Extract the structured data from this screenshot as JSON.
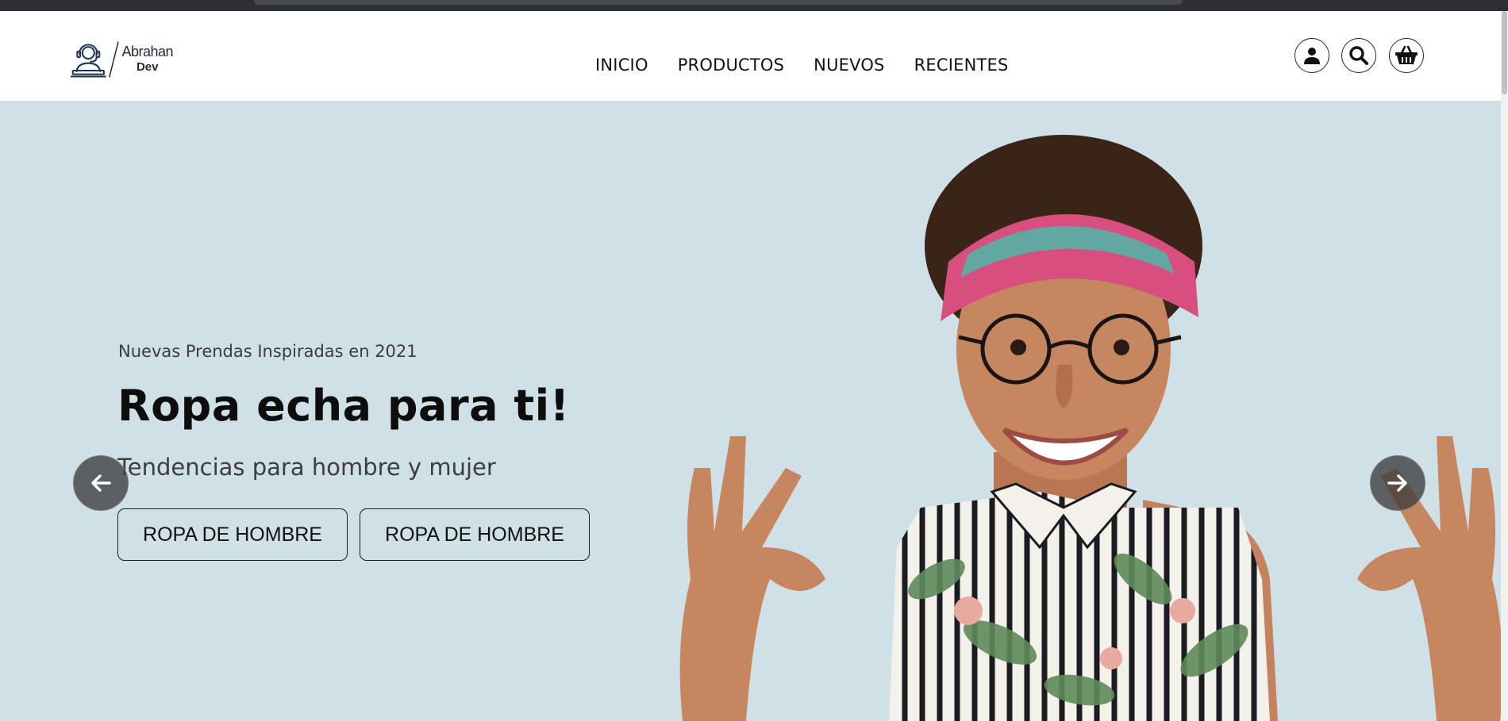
{
  "brand": {
    "line1": "Abrahan",
    "line2": "Dev"
  },
  "nav": [
    "INICIO",
    "PRODUCTOS",
    "NUEVOS",
    "RECIENTES"
  ],
  "header_icons": [
    "user-icon",
    "search-icon",
    "basket-icon"
  ],
  "hero": {
    "kicker": "Nuevas Prendas Inspiradas en 2021",
    "title": "Ropa echa para ti!",
    "subtitle": "Tendencias para hombre y mujer",
    "buttons": [
      "ROPA DE HOMBRE",
      "ROPA DE HOMBRE"
    ]
  },
  "carousel_icons": [
    "arrow-left-icon",
    "arrow-right-icon"
  ],
  "colors": {
    "hero_background": "#d0e0e7",
    "header_background": "#ffffff",
    "arrow_button": "#3c3c3c"
  }
}
